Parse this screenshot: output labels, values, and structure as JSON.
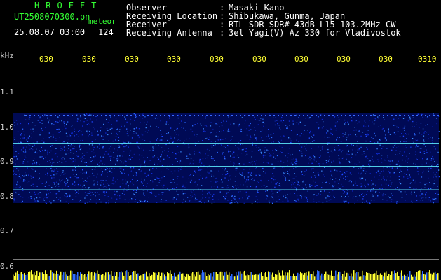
{
  "header": {
    "brand": "HROFFT",
    "filename": "UT2508070300.pn",
    "mode": "meteor",
    "datetime": "25.08.07 03:00",
    "count": "124"
  },
  "info": [
    {
      "label": "Observer",
      "value": "Masaki Kano"
    },
    {
      "label": "Receiving Location",
      "value": "Shibukawa, Gunma, Japan"
    },
    {
      "label": "Receiver",
      "value": "RTL-SDR SDR# 43dB L15 103.2MHz CW"
    },
    {
      "label": "Receiving Antenna",
      "value": "3el Yagi(V) Az 330 for Vladivostok"
    }
  ],
  "axis": {
    "unit": "kHz",
    "y_labels": [
      "1.1",
      "1.0",
      "0.9",
      "0.8",
      "0.7",
      "0.6"
    ]
  },
  "time_ticks": [
    "030",
    "030",
    "030",
    "030",
    "030",
    "030",
    "030",
    "030",
    "030",
    "0310"
  ],
  "colors": {
    "header_green": "#33ff33",
    "text_white": "#ffffff",
    "tick_yellow": "#ffff33",
    "noise_blue": "#1a3aff",
    "echo_line": "#5ff0ff"
  }
}
